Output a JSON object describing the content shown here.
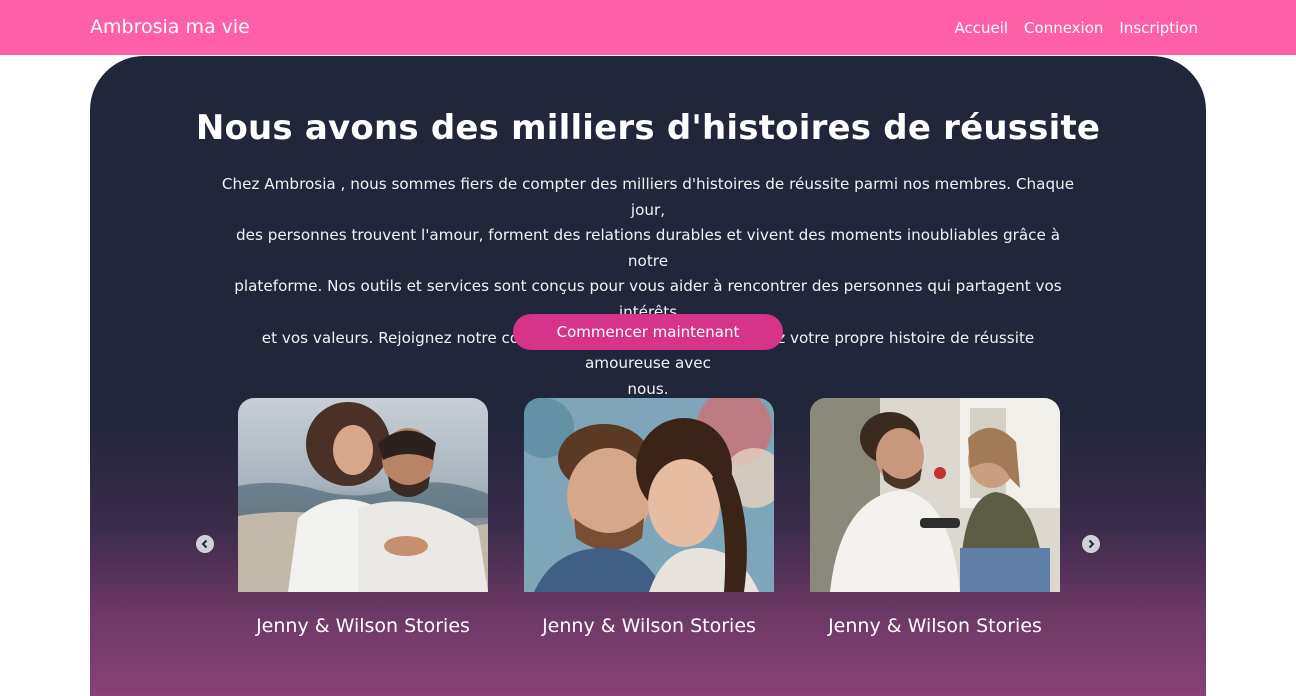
{
  "navbar": {
    "brand": "Ambrosia ma vie",
    "links": [
      "Accueil",
      "Connexion",
      "Inscription"
    ]
  },
  "hero": {
    "title": "Nous avons des milliers d'histoires de réussite",
    "text_lines": [
      "Chez Ambrosia , nous sommes fiers de compter des milliers d'histoires de réussite parmi nos membres. Chaque jour,",
      "des personnes trouvent l'amour, forment des relations durables et vivent des moments inoubliables grâce à notre",
      "plateforme. Nos outils et services sont conçus pour vous aider à rencontrer des personnes qui partagent vos intérêts",
      "et vos valeurs. Rejoignez notre communauté grandissante et écrivez votre propre histoire de réussite amoureuse avec",
      "nous."
    ],
    "cta_label": "Commencer maintenant"
  },
  "carousel": {
    "cards": [
      {
        "caption": "Jenny & Wilson Stories"
      },
      {
        "caption": "Jenny & Wilson Stories"
      },
      {
        "caption": "Jenny & Wilson Stories"
      }
    ]
  },
  "colors": {
    "navbar": "#ff5fa8",
    "hero_top": "#22263a",
    "hero_bottom": "#8a4173",
    "cta": "#d63489"
  },
  "icons": {
    "prev": "chevron-left-icon",
    "next": "chevron-right-icon"
  }
}
